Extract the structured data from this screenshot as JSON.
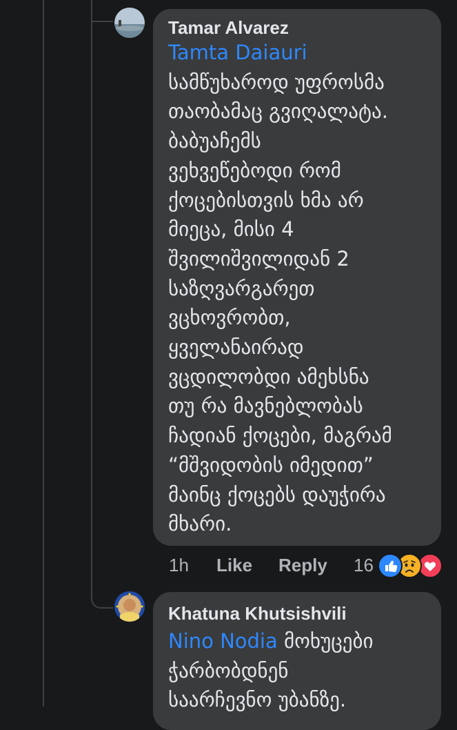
{
  "comment1": {
    "author": "Tamar Alvarez",
    "mention": "Tamta Daiauri",
    "lines": [
      "სამწუხაროდ უფროსმა",
      "თაობამაც გვიღალატა.",
      "ბაბუაჩემს",
      "ვეხვეწებოდი რომ",
      "ქოცებისთვის ხმა არ",
      "მიეცა, მისი 4",
      "შვილიშვილიდან 2",
      "საზღვარგარეთ",
      "ვცხოვრობთ,",
      "ყველანაირად",
      "ვცდილობდი ამეხსნა",
      "თუ რა მავნებლობას",
      "ჩადიან ქოცები, მაგრამ",
      "“მშვიდობის იმედით”",
      "მაინც ქოცებს დაუჭირა",
      "მხარი."
    ],
    "time": "1h",
    "like_label": "Like",
    "reply_label": "Reply",
    "reaction_count": "16",
    "reactions": [
      "like-reaction-icon",
      "sad-reaction-icon",
      "love-reaction-icon"
    ],
    "colors": {
      "like": "#2d88ff",
      "sad": "#f7b125",
      "love": "#f33e58"
    }
  },
  "comment2": {
    "author": "Khatuna Khutsishvili",
    "mention": "Nino Nodia",
    "first_line_rest": " მოხუცები",
    "lines": [
      "ჭარბობდნენ",
      "საარჩევნო უბანზე."
    ]
  },
  "theme": {
    "background": "#18191a",
    "bubble": "#3a3b3c",
    "link": "#2d88ff",
    "secondary_text": "#b0b3b8"
  }
}
